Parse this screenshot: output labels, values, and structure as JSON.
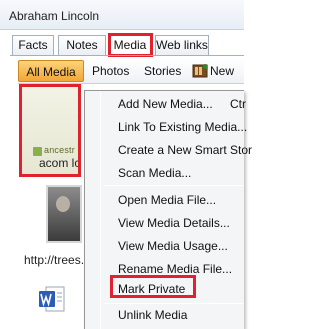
{
  "window": {
    "title": "Abraham Lincoln"
  },
  "tabs": {
    "facts": "Facts",
    "notes": "Notes",
    "media": "Media",
    "weblinks": "Web links"
  },
  "toolbar": {
    "all_media": "All Media",
    "photos": "Photos",
    "stories": "Stories",
    "new": "New"
  },
  "media_items": [
    {
      "caption": "acom lc",
      "overlay": "ancestr"
    },
    {
      "caption": "http://trees."
    }
  ],
  "context_menu": {
    "items": [
      "Add New Media...",
      "Link To Existing Media...",
      "Create a New Smart Stor",
      "Scan Media...",
      "Open Media File...",
      "View Media Details...",
      "View Media Usage...",
      "Rename Media File...",
      "Mark Private",
      "Unlink Media"
    ],
    "shortcut_partial": "Ctr"
  },
  "colors": {
    "highlight": "#e0222f",
    "active_filter": "#f2a638"
  }
}
